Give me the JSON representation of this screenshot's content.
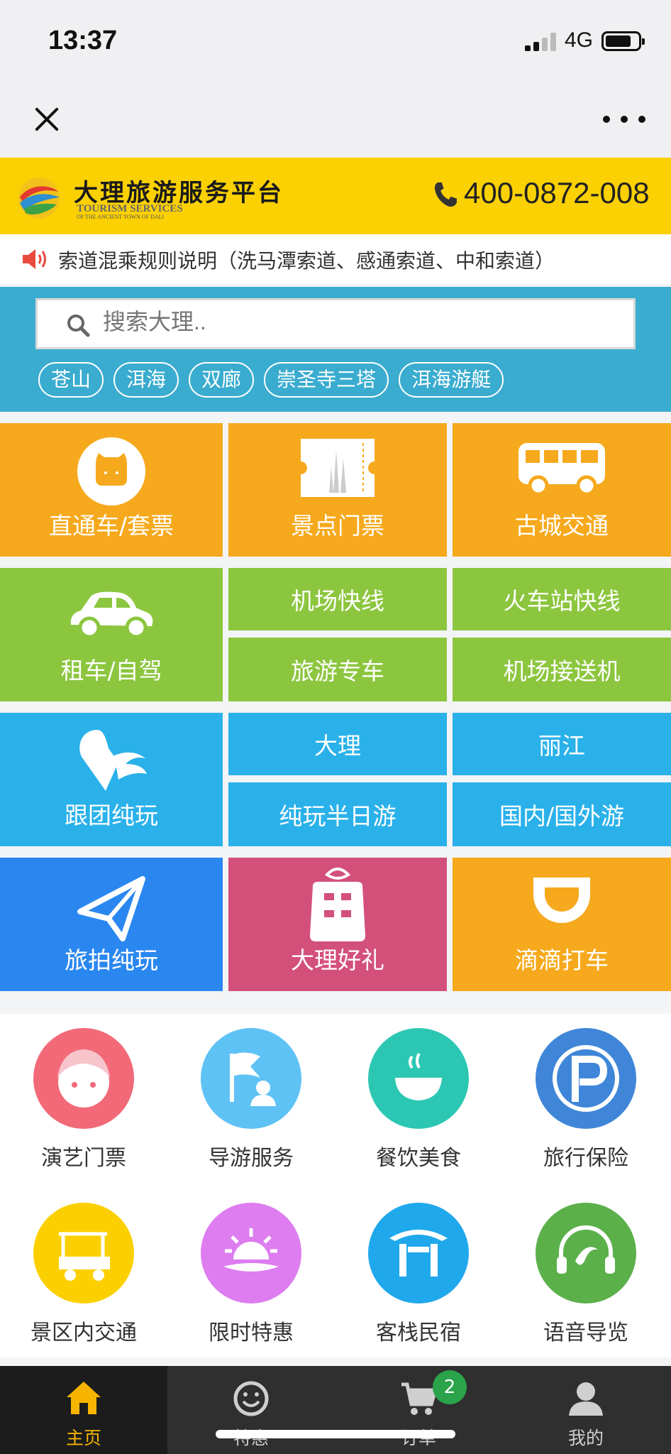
{
  "status": {
    "time": "13:37",
    "network": "4G"
  },
  "brand": {
    "name": "大理旅游服务平台",
    "subtitle_line1": "TOURISM SERVICES",
    "subtitle_line2": "OF THE ANCIENT TOWN OF DALI",
    "phone": "400-0872-008",
    "color": "#fcd104"
  },
  "notice": {
    "text": "索道混乘规则说明（洗马潭索道、感通索道、中和索道）"
  },
  "search": {
    "placeholder": "搜索大理..",
    "tags": [
      "苍山",
      "洱海",
      "双廊",
      "崇圣寺三塔",
      "洱海游艇"
    ]
  },
  "grid": {
    "through_bus": "直通车/套票",
    "scenic_tickets": "景点门票",
    "old_town_transport": "古城交通",
    "car_rental": "租车/自驾",
    "airport_express": "机场快线",
    "train_station_express": "火车站快线",
    "tour_car": "旅游专车",
    "airport_transfer": "机场接送机",
    "group_tour": "跟团纯玩",
    "dali": "大理",
    "lijiang": "丽江",
    "half_day": "纯玩半日游",
    "domestic_abroad": "国内/国外游",
    "photo_tour": "旅拍纯玩",
    "dali_gifts": "大理好礼",
    "didi": "滴滴打车"
  },
  "icons": [
    {
      "label": "演艺门票",
      "color": "#f26a78",
      "icon": "performer-icon"
    },
    {
      "label": "导游服务",
      "color": "#5ec2f5",
      "icon": "guide-flag-icon"
    },
    {
      "label": "餐饮美食",
      "color": "#2cc7b3",
      "icon": "bowl-icon"
    },
    {
      "label": "旅行保险",
      "color": "#3f86d9",
      "icon": "insurance-icon"
    },
    {
      "label": "景区内交通",
      "color": "#fcd000",
      "icon": "golf-cart-icon"
    },
    {
      "label": "限时特惠",
      "color": "#dd7df0",
      "icon": "sunrise-icon"
    },
    {
      "label": "客栈民宿",
      "color": "#1fa8ec",
      "icon": "inn-icon"
    },
    {
      "label": "语音导览",
      "color": "#5bb04a",
      "icon": "headphones-icon"
    }
  ],
  "tabs": [
    {
      "label": "主页",
      "icon": "home-icon"
    },
    {
      "label": "特惠",
      "icon": "smile-icon"
    },
    {
      "label": "订单",
      "icon": "cart-icon"
    },
    {
      "label": "我的",
      "icon": "user-icon"
    }
  ],
  "cart_badge": "2"
}
